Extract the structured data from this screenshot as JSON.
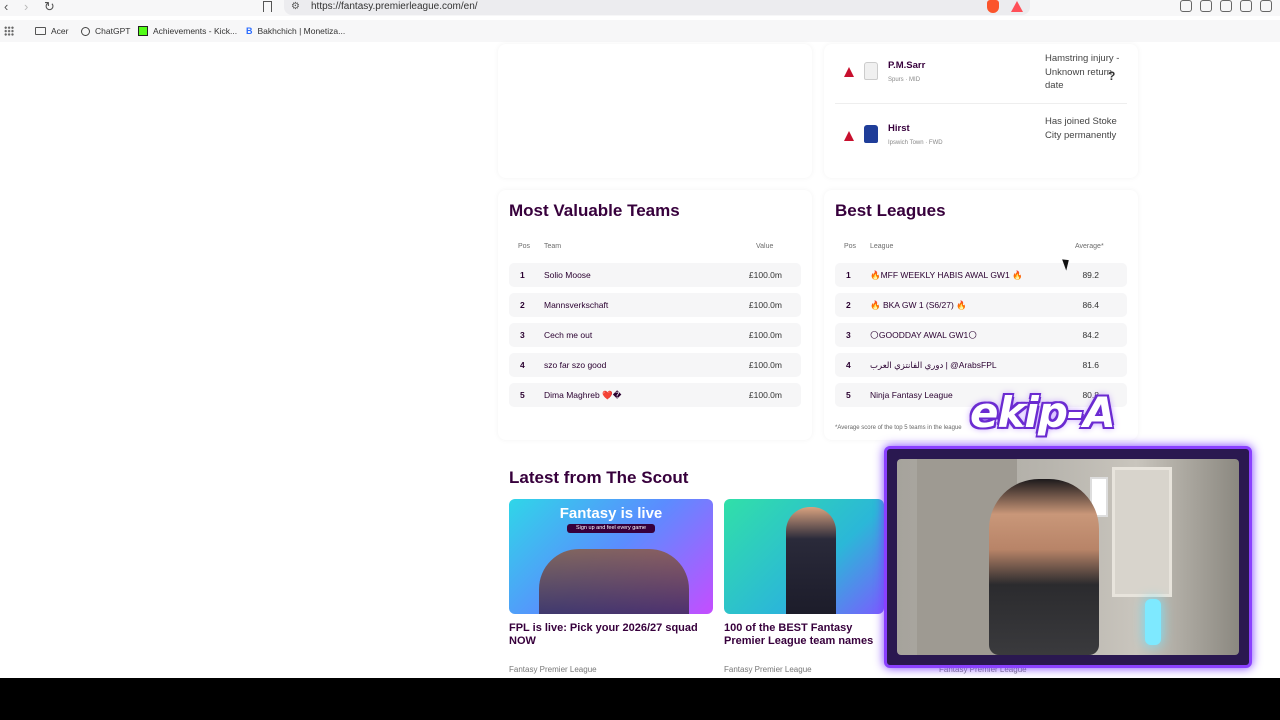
{
  "browser": {
    "url": "https://fantasy.premierleague.com/en/",
    "bookmarks": [
      "Acer",
      "ChatGPT",
      "Achievements - Kick...",
      "Bakhchich | Monetiza..."
    ]
  },
  "injuries": [
    {
      "name": "P.M.Sarr",
      "club": "Spurs",
      "position": "MID",
      "status": "Hamstring injury - Unknown return date"
    },
    {
      "name": "Hirst",
      "club": "Ipswich Town",
      "position": "FWD",
      "status": "Has joined Stoke City permanently"
    }
  ],
  "most_valuable": {
    "title": "Most Valuable Teams",
    "columns": {
      "pos": "Pos",
      "team": "Team",
      "value": "Value"
    },
    "rows": [
      {
        "pos": "1",
        "team": "Solio Moose",
        "value": "£100.0m"
      },
      {
        "pos": "2",
        "team": "Mannsverkschaft",
        "value": "£100.0m"
      },
      {
        "pos": "3",
        "team": "Cech me out",
        "value": "£100.0m"
      },
      {
        "pos": "4",
        "team": "szo far szo good",
        "value": "£100.0m"
      },
      {
        "pos": "5",
        "team": "Dima Maghreb ❤️�",
        "value": "£100.0m"
      }
    ]
  },
  "best_leagues": {
    "title": "Best Leagues",
    "columns": {
      "pos": "Pos",
      "league": "League",
      "average": "Average*"
    },
    "rows": [
      {
        "pos": "1",
        "league": "🔥MFF WEEKLY HABIS AWAL GW1 🔥",
        "average": "89.2"
      },
      {
        "pos": "2",
        "league": "🔥 BKA GW 1 (S6/27) 🔥",
        "average": "86.4"
      },
      {
        "pos": "3",
        "league": "🌕GOODDAY AWAL GW1🌕",
        "average": "84.2"
      },
      {
        "pos": "4",
        "league": "دوري الفانتزي العرب | @ArabsFPL",
        "average": "81.6"
      },
      {
        "pos": "5",
        "league": "Ninja Fantasy League",
        "average": "80.8"
      }
    ],
    "footnote": "*Average score of the top 5 teams in the league"
  },
  "scout": {
    "title": "Latest from The Scout",
    "articles": [
      {
        "title": "FPL is live: Pick your 2026/27 squad NOW",
        "source": "Fantasy Premier League",
        "banner": "Fantasy is live",
        "banner_sub": "Sign up and feel every game"
      },
      {
        "title": "100 of the BEST Fantasy Premier League team names",
        "source": "Fantasy Premier League"
      },
      {
        "title": "",
        "source": "Fantasy Premier League"
      }
    ]
  },
  "overlay": {
    "brand": "ekip-A"
  },
  "colors": {
    "primary": "#37003c",
    "warning": "#c8102e",
    "overlay_purple": "#8a40ff"
  }
}
